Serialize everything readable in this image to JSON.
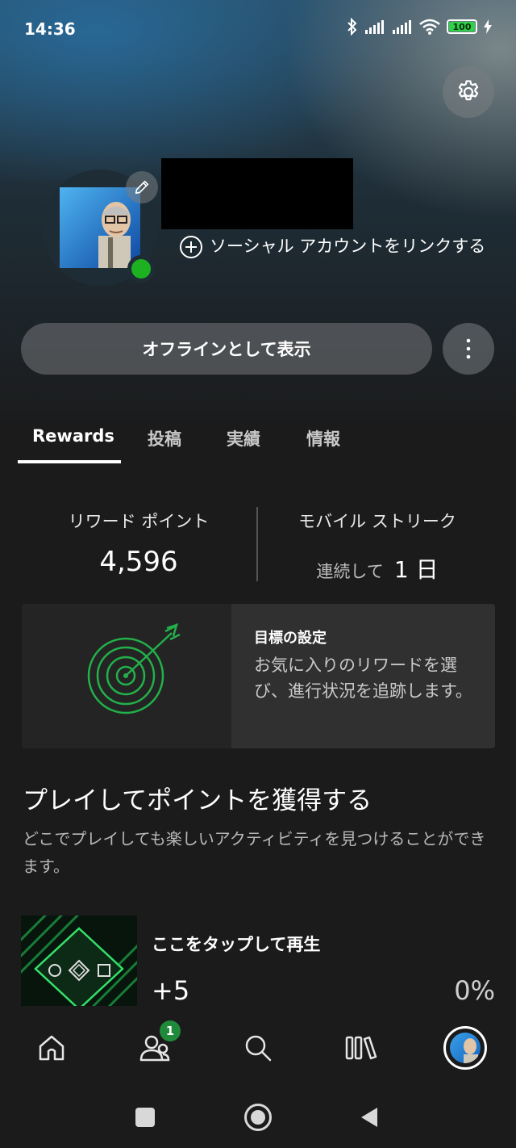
{
  "status_bar": {
    "time": "14:36",
    "battery": "100",
    "icons": [
      "bluetooth-icon",
      "signal-icon",
      "signal-icon",
      "wifi-icon",
      "battery-icon",
      "charging-icon"
    ]
  },
  "profile": {
    "link_social": "ソーシャル アカウントをリンクする",
    "offline_button": "オフラインとして表示",
    "online_color": "#1db021"
  },
  "tabs": [
    {
      "label": "Rewards",
      "active": true
    },
    {
      "label": "投稿",
      "active": false
    },
    {
      "label": "実績",
      "active": false
    },
    {
      "label": "情報",
      "active": false
    }
  ],
  "stats": {
    "points_label": "リワード ポイント",
    "points_value": "4,596",
    "streak_label": "モバイル ストリーク",
    "streak_prefix": "連続して",
    "streak_value": "1 日"
  },
  "goal": {
    "title": "目標の設定",
    "description": "お気に入りのリワードを選び、進行状況を追跡します。",
    "accent": "#22b04a"
  },
  "section": {
    "title": "プレイしてポイントを獲得する",
    "description": "どこでプレイしても楽しいアクティビティを見つけることができます。"
  },
  "activity": {
    "title": "ここをタップして再生",
    "points": "+5",
    "progress": "0%"
  },
  "bottom_nav": {
    "items": [
      "home-icon",
      "friends-icon",
      "search-icon",
      "library-icon",
      "profile-avatar"
    ],
    "friends_badge": "1"
  }
}
